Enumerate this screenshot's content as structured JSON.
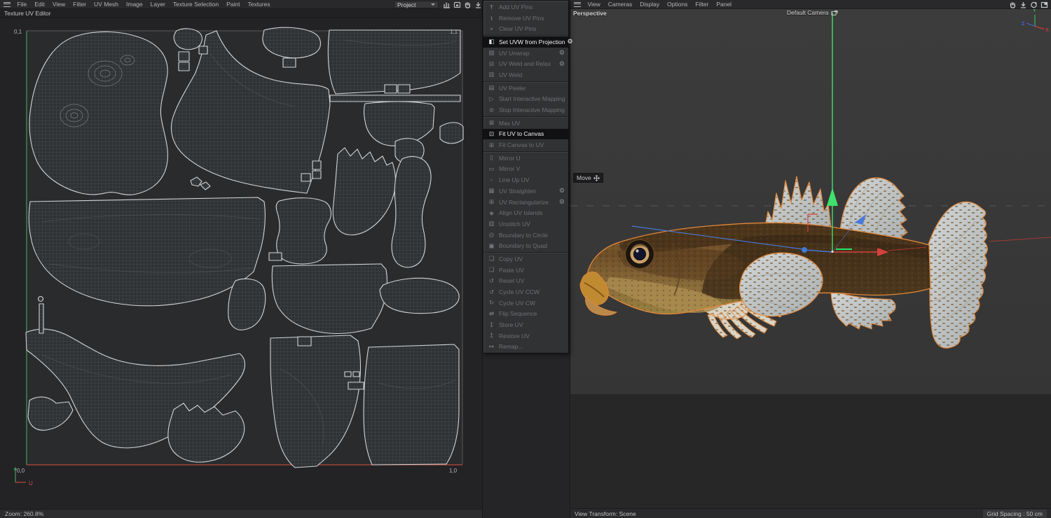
{
  "left_menubar": [
    "File",
    "Edit",
    "View",
    "Filter",
    "UV Mesh",
    "Image",
    "Layer",
    "Texture Selection",
    "Paint",
    "Textures"
  ],
  "right_menubar": [
    "View",
    "Cameras",
    "Display",
    "Options",
    "Filter",
    "Panel"
  ],
  "project_selector": {
    "label": "Project"
  },
  "left_title": "Texture UV Editor",
  "left_status": "Zoom: 260.8%",
  "uv_canvas": {
    "top_left": "0,1",
    "top_right": "1,1",
    "bottom_left": "0,0",
    "bottom_right": "1,0",
    "u_label": "U"
  },
  "viewport": {
    "projection": "Perspective",
    "camera": "Default Camera",
    "tool": "Move",
    "status_left": "View Transform: Scene",
    "status_right": "Grid Spacing : 50 cm",
    "axis": {
      "x": "X",
      "y": "Y",
      "z": "Z"
    }
  },
  "icons": {
    "gear": "⚙"
  },
  "colors": {
    "selection_outline": "#e1873a",
    "axis_x": "#d84040",
    "axis_y": "#3fe06c",
    "axis_z": "#4a78d8",
    "uv_u_axis": "#b8493a",
    "uv_v_axis": "#3f9e5f",
    "menu_enabled_bg": "#111113",
    "panel_bg": "#232325",
    "viewport_bg": "#3a3a3a"
  },
  "uv_menu": {
    "groups": [
      {
        "items": [
          {
            "label": "Add UV Pins",
            "icon_name": "pin-add-icon",
            "glyph": "Ŧ",
            "enabled": false
          },
          {
            "label": "Remove UV Pins",
            "icon_name": "pin-remove-icon",
            "glyph": "ŧ",
            "enabled": false
          },
          {
            "label": "Clear UV Pins",
            "icon_name": "pin-clear-icon",
            "glyph": "×",
            "enabled": false
          }
        ]
      },
      {
        "items": [
          {
            "label": "Set UVW from Projection",
            "icon_name": "projection-icon",
            "glyph": "◧",
            "enabled": true,
            "gear": true
          },
          {
            "label": "UV Unwrap",
            "icon_name": "unwrap-icon",
            "glyph": "▨",
            "enabled": false,
            "gear": true
          },
          {
            "label": "UV Weld and Relax",
            "icon_name": "weld-relax-icon",
            "glyph": "⊟",
            "enabled": false,
            "gear": true
          },
          {
            "label": "UV Weld",
            "icon_name": "weld-icon",
            "glyph": "▥",
            "enabled": false
          }
        ]
      },
      {
        "items": [
          {
            "label": "UV Peeler",
            "icon_name": "peeler-icon",
            "glyph": "▤",
            "enabled": false
          },
          {
            "label": "Start Interactive Mapping",
            "icon_name": "play-icon",
            "glyph": "▷",
            "enabled": false
          },
          {
            "label": "Stop Interactive Mapping",
            "icon_name": "stop-icon",
            "glyph": "⊘",
            "enabled": false
          }
        ]
      },
      {
        "items": [
          {
            "label": "Max UV",
            "icon_name": "max-uv-icon",
            "glyph": "⊠",
            "enabled": false
          },
          {
            "label": "Fit UV to Canvas",
            "icon_name": "fit-canvas-icon",
            "glyph": "⊡",
            "enabled": true
          },
          {
            "label": "Fit Canvas to UV",
            "icon_name": "fit-uv-icon",
            "glyph": "⊞",
            "enabled": false
          }
        ]
      },
      {
        "items": [
          {
            "label": "Mirror U",
            "icon_name": "mirror-u-icon",
            "glyph": "▯",
            "enabled": false
          },
          {
            "label": "Mirror V",
            "icon_name": "mirror-v-icon",
            "glyph": "▭",
            "enabled": false
          },
          {
            "label": "Line Up UV",
            "icon_name": "lineup-icon",
            "glyph": "▫",
            "enabled": false
          },
          {
            "label": "UV Straighten",
            "icon_name": "straighten-icon",
            "glyph": "▦",
            "enabled": false,
            "gear": true
          },
          {
            "label": "UV Rectangularize",
            "icon_name": "rectangularize-icon",
            "glyph": "⊞",
            "enabled": false,
            "gear": true
          },
          {
            "label": "Align UV Islands",
            "icon_name": "align-islands-icon",
            "glyph": "◈",
            "enabled": false
          },
          {
            "label": "Unstitch UV",
            "icon_name": "unstitch-icon",
            "glyph": "▥",
            "enabled": false
          },
          {
            "label": "Boundary to Circle",
            "icon_name": "boundary-circle-icon",
            "glyph": "◎",
            "enabled": false
          },
          {
            "label": "Boundary to Quad",
            "icon_name": "boundary-quad-icon",
            "glyph": "▣",
            "enabled": false
          }
        ]
      },
      {
        "items": [
          {
            "label": "Copy UV",
            "icon_name": "copy-icon",
            "glyph": "❏",
            "enabled": false
          },
          {
            "label": "Paste UV",
            "icon_name": "paste-icon",
            "glyph": "❑",
            "enabled": false
          },
          {
            "label": "Reset UV",
            "icon_name": "reset-icon",
            "glyph": "↺",
            "enabled": false
          },
          {
            "label": "Cycle UV CCW",
            "icon_name": "cycle-ccw-icon",
            "glyph": "↺",
            "enabled": false
          },
          {
            "label": "Cycle UV CW",
            "icon_name": "cycle-cw-icon",
            "glyph": "↻",
            "enabled": false
          },
          {
            "label": "Flip Sequence",
            "icon_name": "flip-sequence-icon",
            "glyph": "⇄",
            "enabled": false
          },
          {
            "label": "Store UV",
            "icon_name": "store-icon",
            "glyph": "↧",
            "enabled": false
          },
          {
            "label": "Restore UV",
            "icon_name": "restore-icon",
            "glyph": "↥",
            "enabled": false
          },
          {
            "label": "Remap...",
            "icon_name": "remap-icon",
            "glyph": "↦",
            "enabled": false
          }
        ]
      }
    ]
  }
}
